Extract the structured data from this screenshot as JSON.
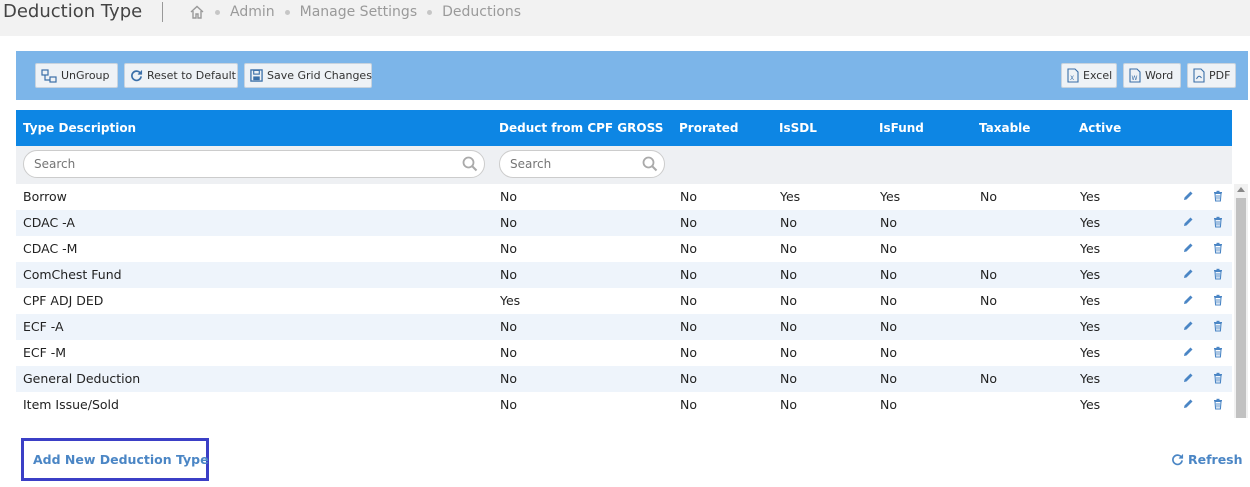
{
  "header": {
    "title": "Deduction Type",
    "breadcrumb": [
      "Admin",
      "Manage Settings",
      "Deductions"
    ]
  },
  "toolbar": {
    "ungroup": "UnGroup",
    "reset": "Reset to Default",
    "save": "Save Grid Changes",
    "excel": "Excel",
    "word": "Word",
    "pdf": "PDF"
  },
  "grid": {
    "columns": [
      "Type Description",
      "Deduct from CPF GROSS",
      "Prorated",
      "IsSDL",
      "IsFund",
      "Taxable",
      "Active"
    ],
    "search_placeholder": "Search",
    "rows": [
      [
        "Borrow",
        "No",
        "No",
        "Yes",
        "Yes",
        "No",
        "Yes"
      ],
      [
        "CDAC -A",
        "No",
        "No",
        "No",
        "No",
        "",
        "Yes"
      ],
      [
        "CDAC -M",
        "No",
        "No",
        "No",
        "No",
        "",
        "Yes"
      ],
      [
        "ComChest Fund",
        "No",
        "No",
        "No",
        "No",
        "No",
        "Yes"
      ],
      [
        "CPF ADJ DED",
        "Yes",
        "No",
        "No",
        "No",
        "No",
        "Yes"
      ],
      [
        "ECF -A",
        "No",
        "No",
        "No",
        "No",
        "",
        "Yes"
      ],
      [
        "ECF -M",
        "No",
        "No",
        "No",
        "No",
        "",
        "Yes"
      ],
      [
        "General Deduction",
        "No",
        "No",
        "No",
        "No",
        "No",
        "Yes"
      ],
      [
        "Item Issue/Sold",
        "No",
        "No",
        "No",
        "No",
        "",
        "Yes"
      ]
    ]
  },
  "footer": {
    "add_label": "Add New Deduction Type",
    "refresh_label": "Refresh"
  },
  "colors": {
    "toolbar_bg": "#7cb5e9",
    "header_bg": "#0d86e4",
    "link": "#4b86c5",
    "highlight_border": "#3b3fc6"
  }
}
